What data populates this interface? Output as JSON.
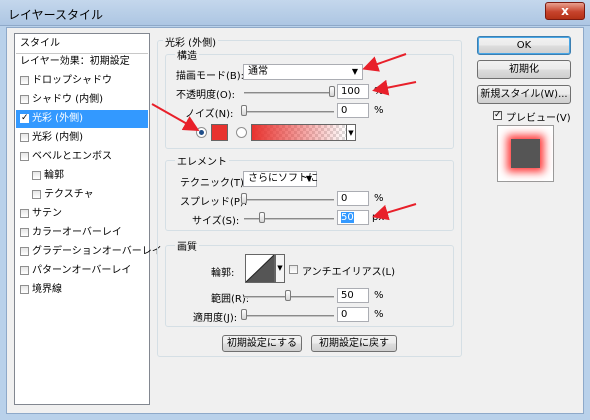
{
  "window": {
    "title": "レイヤースタイル",
    "close_label": "x"
  },
  "sidebar": {
    "header": "スタイル",
    "items": [
      {
        "label": "レイヤー効果：初期設定",
        "checkbox": false,
        "checked": false,
        "selected": false,
        "indent": 0
      },
      {
        "label": "ドロップシャドウ",
        "checkbox": true,
        "checked": false,
        "selected": false,
        "indent": 0
      },
      {
        "label": "シャドウ (内側)",
        "checkbox": true,
        "checked": false,
        "selected": false,
        "indent": 0
      },
      {
        "label": "光彩 (外側)",
        "checkbox": true,
        "checked": true,
        "selected": true,
        "indent": 0
      },
      {
        "label": "光彩 (内側)",
        "checkbox": true,
        "checked": false,
        "selected": false,
        "indent": 0
      },
      {
        "label": "ベベルとエンボス",
        "checkbox": true,
        "checked": false,
        "selected": false,
        "indent": 0
      },
      {
        "label": "輪郭",
        "checkbox": true,
        "checked": false,
        "selected": false,
        "indent": 1
      },
      {
        "label": "テクスチャ",
        "checkbox": true,
        "checked": false,
        "selected": false,
        "indent": 1
      },
      {
        "label": "サテン",
        "checkbox": true,
        "checked": false,
        "selected": false,
        "indent": 0
      },
      {
        "label": "カラーオーバーレイ",
        "checkbox": true,
        "checked": false,
        "selected": false,
        "indent": 0
      },
      {
        "label": "グラデーションオーバーレイ",
        "checkbox": true,
        "checked": false,
        "selected": false,
        "indent": 0
      },
      {
        "label": "パターンオーバーレイ",
        "checkbox": true,
        "checked": false,
        "selected": false,
        "indent": 0
      },
      {
        "label": "境界線",
        "checkbox": true,
        "checked": false,
        "selected": false,
        "indent": 0
      }
    ]
  },
  "panel": {
    "title": "光彩 (外側)",
    "structure": {
      "title": "構造",
      "blend_mode_label": "描画モード(B):",
      "blend_mode_value": "通常",
      "opacity_label": "不透明度(O):",
      "opacity_value": "100",
      "opacity_unit": "%",
      "opacity_level": 1.0,
      "noise_label": "ノイズ(N):",
      "noise_value": "0",
      "noise_unit": "%",
      "noise_level": 0.0,
      "color_swatch": "#e8322e",
      "gradient_start": "#e8322e"
    },
    "elements": {
      "title": "エレメント",
      "technique_label": "テクニック(T):",
      "technique_value": "さらにソフトに",
      "spread_label": "スプレッド(P):",
      "spread_value": "0",
      "spread_unit": "%",
      "spread_level": 0.0,
      "size_label": "サイズ(S):",
      "size_value": "50",
      "size_unit": "px",
      "size_level": 0.2
    },
    "quality": {
      "title": "画質",
      "contour_label": "輪郭:",
      "antialias_label": "アンチエイリアス(L)",
      "range_label": "範囲(R):",
      "range_value": "50",
      "range_unit": "%",
      "range_level": 0.5,
      "jitter_label": "適用度(J):",
      "jitter_value": "0",
      "jitter_unit": "%",
      "jitter_level": 0.0
    },
    "make_default_label": "初期設定にする",
    "reset_default_label": "初期設定に戻す"
  },
  "right": {
    "ok_label": "OK",
    "reset_label": "初期化",
    "new_style_label": "新規スタイル(W)...",
    "preview_label": "プレビュー(V)",
    "preview_checked": true
  },
  "colors": {
    "selection": "#3399ff",
    "glow": "#ff3a3a",
    "annotation_arrow": "#e8202a"
  }
}
